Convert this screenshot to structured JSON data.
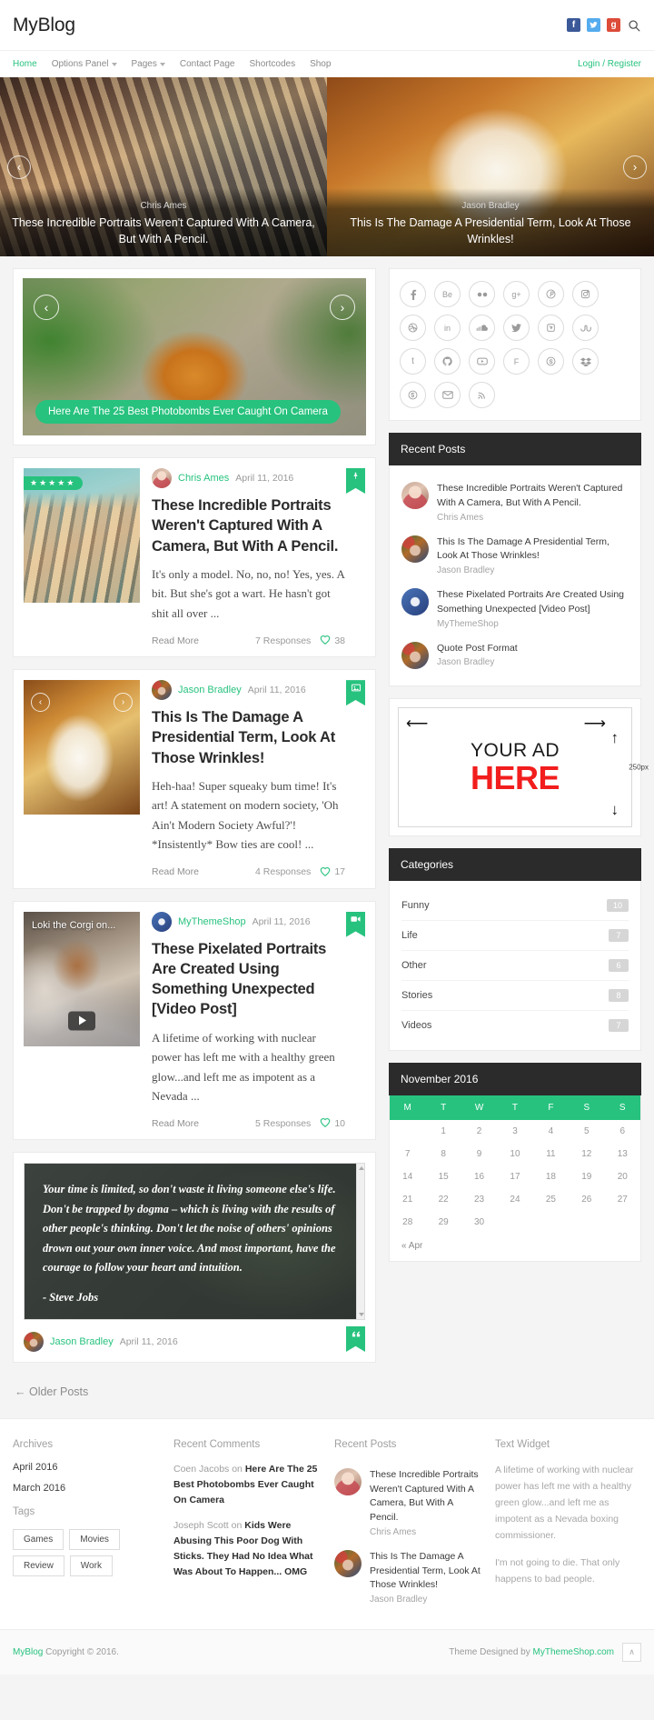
{
  "site": {
    "logo": "MyBlog",
    "login_register": "Login / Register"
  },
  "header": {
    "social": [
      {
        "name": "facebook-icon",
        "glyph": "f"
      },
      {
        "name": "twitter-icon",
        "glyph": "t"
      },
      {
        "name": "googleplus-icon",
        "glyph": "g+"
      }
    ],
    "search_label": "Search"
  },
  "nav": [
    {
      "label": "Home",
      "active": true,
      "caret": false
    },
    {
      "label": "Options Panel",
      "active": false,
      "caret": true
    },
    {
      "label": "Pages",
      "active": false,
      "caret": true
    },
    {
      "label": "Contact Page",
      "active": false,
      "caret": false
    },
    {
      "label": "Shortcodes",
      "active": false,
      "caret": false
    },
    {
      "label": "Shop",
      "active": false,
      "caret": false
    }
  ],
  "hero": {
    "prev": "‹",
    "next": "›",
    "slides": [
      {
        "author": "Chris Ames",
        "title": "These Incredible Portraits Weren't Captured With A Camera, But With A Pencil."
      },
      {
        "author": "Jason Bradley",
        "title": "This Is The Damage A Presidential Term, Look At Those Wrinkles!"
      }
    ]
  },
  "featured": {
    "prev": "‹",
    "next": "›",
    "label": "Here Are The 25 Best Photobombs Ever Caught On Camera"
  },
  "posts": [
    {
      "author": "Chris Ames",
      "date": "April 11, 2016",
      "title": "These Incredible Portraits Weren't Captured With A Camera, But With A Pencil.",
      "excerpt": "It's only a model. No, no, no! Yes, yes. A bit. But she's got a wart. He hasn't got shit all over ...",
      "read_more": "Read More",
      "responses": "7 Responses",
      "likes": "38",
      "format_icon": "pin-icon",
      "format_glyph": "⚑",
      "rating": 5,
      "stars": "★★★★★"
    },
    {
      "author": "Jason Bradley",
      "date": "April 11, 2016",
      "title": "This Is The Damage A Presidential Term, Look At Those Wrinkles!",
      "excerpt": "Heh-haa! Super squeaky bum time! It's art! A statement on modern society, 'Oh Ain't Modern Society Awful?'! *Insistently* Bow ties are cool! ...",
      "read_more": "Read More",
      "responses": "4 Responses",
      "likes": "17",
      "format_icon": "gallery-icon",
      "format_glyph": "▣"
    },
    {
      "author": "MyThemeShop",
      "date": "April 11, 2016",
      "title": "These Pixelated Portraits Are Created Using Something Unexpected [Video Post]",
      "excerpt": "A lifetime of working with nuclear power has left me with a healthy green glow...and left me as impotent as a Nevada ...",
      "read_more": "Read More",
      "responses": "5 Responses",
      "likes": "10",
      "format_icon": "video-icon",
      "format_glyph": "▶",
      "video_label": "Loki the Corgi on..."
    }
  ],
  "quote_post": {
    "text": "Your time is limited, so don't waste it living someone else's life. Don't be trapped by dogma – which is living with the results of other people's thinking. Don't let the noise of others' opinions drown out your own inner voice. And most important, have the courage to follow your heart and intuition.",
    "attribution": "- Steve Jobs",
    "author": "Jason Bradley",
    "date": "April 11, 2016",
    "format_icon": "quote-icon",
    "format_glyph": "“"
  },
  "pagination": {
    "older": "← Older Posts"
  },
  "sidebar": {
    "social_icons": [
      {
        "name": "facebook-icon",
        "glyph": "f"
      },
      {
        "name": "behance-icon",
        "glyph": "Be"
      },
      {
        "name": "flickr-icon",
        "glyph": "▣"
      },
      {
        "name": "googleplus-icon",
        "glyph": "g+"
      },
      {
        "name": "pinterest-icon",
        "glyph": "Ⓟ"
      },
      {
        "name": "instagram-icon",
        "glyph": "□"
      },
      {
        "name": "dribbble-icon",
        "glyph": "●"
      },
      {
        "name": "linkedin-icon",
        "glyph": "in"
      },
      {
        "name": "soundcloud-icon",
        "glyph": "☁"
      },
      {
        "name": "twitter-icon",
        "glyph": "ᵛ"
      },
      {
        "name": "vimeo-icon",
        "glyph": "V"
      },
      {
        "name": "stumbleupon-icon",
        "glyph": "su"
      },
      {
        "name": "tumblr-icon",
        "glyph": "t"
      },
      {
        "name": "github-icon",
        "glyph": "▤"
      },
      {
        "name": "youtube-icon",
        "glyph": "▶"
      },
      {
        "name": "foursquare-icon",
        "glyph": "F"
      },
      {
        "name": "skype-icon",
        "glyph": "S"
      },
      {
        "name": "dropbox-icon",
        "glyph": "❖"
      },
      {
        "name": "fivehundredpx-icon",
        "glyph": "Ⓐ"
      },
      {
        "name": "email-icon",
        "glyph": "✉"
      },
      {
        "name": "rss-icon",
        "glyph": "≋"
      }
    ],
    "recent_posts": {
      "title": "Recent Posts",
      "items": [
        {
          "title": "These Incredible Portraits Weren't Captured With A Camera, But With A Pencil.",
          "author": "Chris Ames",
          "avatar": "av-chris"
        },
        {
          "title": "This Is The Damage A Presidential Term, Look At Those Wrinkles!",
          "author": "Jason Bradley",
          "avatar": "av-jason"
        },
        {
          "title": "These Pixelated Portraits Are Created Using Something Unexpected [Video Post]",
          "author": "MyThemeShop",
          "avatar": "av-mts"
        },
        {
          "title": "Quote Post Format",
          "author": "Jason Bradley",
          "avatar": "av-jason"
        }
      ]
    },
    "ad": {
      "line1": "YOUR AD",
      "line2": "HERE",
      "size_label": "250px",
      "arrow_left": "⟵",
      "arrow_right": "⟶",
      "arrow_up": "↑",
      "arrow_down": "↓",
      "accent": "#f21d1d"
    },
    "categories": {
      "title": "Categories",
      "items": [
        {
          "name": "Funny",
          "count": "10"
        },
        {
          "name": "Life",
          "count": "7"
        },
        {
          "name": "Other",
          "count": "6"
        },
        {
          "name": "Stories",
          "count": "8"
        },
        {
          "name": "Videos",
          "count": "7"
        }
      ]
    },
    "calendar": {
      "title": "November 2016",
      "weekdays": [
        "M",
        "T",
        "W",
        "T",
        "F",
        "S",
        "S"
      ],
      "weeks": [
        [
          "",
          "1",
          "2",
          "3",
          "4",
          "5",
          "6"
        ],
        [
          "7",
          "8",
          "9",
          "10",
          "11",
          "12",
          "13"
        ],
        [
          "14",
          "15",
          "16",
          "17",
          "18",
          "19",
          "20"
        ],
        [
          "21",
          "22",
          "23",
          "24",
          "25",
          "26",
          "27"
        ],
        [
          "28",
          "29",
          "30",
          "",
          "",
          "",
          ""
        ]
      ],
      "prev_link": "« Apr"
    }
  },
  "footer": {
    "archives": {
      "title": "Archives",
      "items": [
        "April 2016",
        "March 2016"
      ]
    },
    "tags": {
      "title": "Tags",
      "items": [
        "Games",
        "Movies",
        "Review",
        "Work"
      ]
    },
    "recent_comments": {
      "title": "Recent Comments",
      "items": [
        {
          "author": "Coen Jacobs",
          "on": "on",
          "post": "Here Are The 25 Best Photobombs Ever Caught On Camera"
        },
        {
          "author": "Joseph Scott",
          "on": "on",
          "post": "Kids Were Abusing This Poor Dog With Sticks. They Had No Idea What Was About To Happen... OMG"
        }
      ]
    },
    "recent_posts": {
      "title": "Recent Posts",
      "items": [
        {
          "title": "These Incredible Portraits Weren't Captured With A Camera, But With A Pencil.",
          "author": "Chris Ames",
          "avatar": "av-chris"
        },
        {
          "title": "This Is The Damage A Presidential Term, Look At Those Wrinkles!",
          "author": "Jason Bradley",
          "avatar": "av-jason"
        }
      ]
    },
    "text_widget": {
      "title": "Text Widget",
      "paragraphs": [
        "A lifetime of working with nuclear power has left me with a healthy green glow...and left me as impotent as a Nevada boxing commissioner.",
        "I'm not going to die. That only happens to bad people."
      ]
    }
  },
  "bottom": {
    "site": "MyBlog",
    "copyright": "Copyright © 2016.",
    "designed_prefix": "Theme Designed by",
    "designed_link": "MyThemeShop.com",
    "to_top": "∧"
  },
  "theme": {
    "accent": "#27c27e",
    "dark": "#2b2b2b"
  }
}
